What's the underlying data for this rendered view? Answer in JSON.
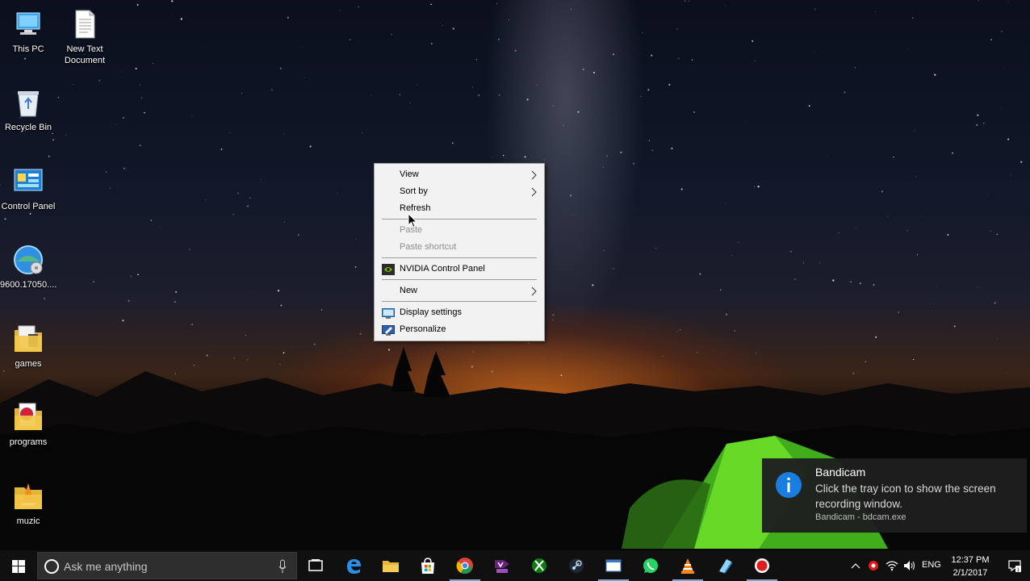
{
  "desktop": {
    "icons": [
      {
        "label": "This PC",
        "icon": "this-pc-icon"
      },
      {
        "label": "New Text Document",
        "icon": "text-document-icon"
      },
      {
        "label": "Recycle Bin",
        "icon": "recycle-bin-icon"
      },
      {
        "label": "Control Panel",
        "icon": "control-panel-icon"
      },
      {
        "label": "9600.17050....",
        "icon": "disc-image-icon"
      },
      {
        "label": "games",
        "icon": "folder-icon"
      },
      {
        "label": "programs",
        "icon": "folder-icon"
      },
      {
        "label": "muzic",
        "icon": "folder-icon"
      }
    ]
  },
  "context_menu": {
    "items": [
      {
        "label": "View",
        "submenu": true,
        "enabled": true
      },
      {
        "label": "Sort by",
        "submenu": true,
        "enabled": true
      },
      {
        "label": "Refresh",
        "submenu": false,
        "enabled": true
      },
      {
        "label": "Paste",
        "submenu": false,
        "enabled": false
      },
      {
        "label": "Paste shortcut",
        "submenu": false,
        "enabled": false
      },
      {
        "label": "NVIDIA Control Panel",
        "submenu": false,
        "enabled": true,
        "icon": "nvidia-icon"
      },
      {
        "label": "New",
        "submenu": true,
        "enabled": true
      },
      {
        "label": "Display settings",
        "submenu": false,
        "enabled": true,
        "icon": "display-icon"
      },
      {
        "label": "Personalize",
        "submenu": false,
        "enabled": true,
        "icon": "personalize-icon"
      }
    ]
  },
  "notification": {
    "title": "Bandicam",
    "message": "Click the tray icon to show the screen recording window.",
    "source": "Bandicam - bdcam.exe",
    "icon": "info-icon"
  },
  "taskbar": {
    "search_placeholder": "Ask me anything",
    "apps": [
      "task-view-icon",
      "edge-icon",
      "file-explorer-icon",
      "store-icon",
      "chrome-icon",
      "visual-studio-icon",
      "xbox-icon",
      "steam-icon",
      "window-icon",
      "whatsapp-icon",
      "vlc-icon",
      "app-icon",
      "bandicam-record-icon"
    ],
    "language": "ENG",
    "time": "12:37 PM",
    "date": "2/1/2017"
  },
  "colors": {
    "menu_bg": "#f2f2f2",
    "taskbar_bg": "#101010",
    "accent_info": "#1a7de0"
  }
}
